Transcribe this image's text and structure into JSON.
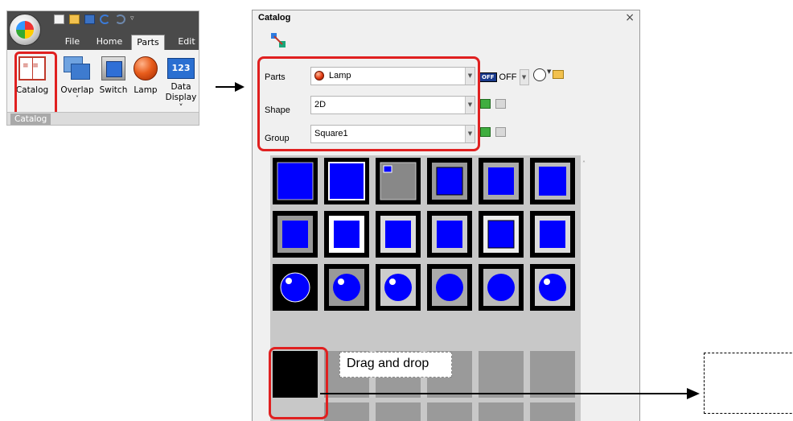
{
  "ribbon": {
    "quick_access_more": "▿",
    "tabs": [
      {
        "label": "File",
        "active": false
      },
      {
        "label": "Home",
        "active": false
      },
      {
        "label": "Parts",
        "active": true
      },
      {
        "label": "Edit",
        "active": false
      }
    ],
    "buttons": [
      {
        "label": "Catalog",
        "icon": "catalog-book-icon"
      },
      {
        "label": "Overlap",
        "label2": "˅",
        "icon": "overlap-icon"
      },
      {
        "label": "Switch",
        "icon": "switch-icon"
      },
      {
        "label": "Lamp",
        "icon": "lamp-icon"
      },
      {
        "label": "Data",
        "label2": "Display ˅",
        "icon": "data-display-icon",
        "icon_text": "123"
      }
    ],
    "group_label": "Catalog"
  },
  "panel": {
    "title": "Catalog",
    "close": "×",
    "parts": {
      "label": "Parts",
      "value": "Lamp"
    },
    "shape": {
      "label": "Shape",
      "value": "2D"
    },
    "group": {
      "label": "Group",
      "value": "Square1"
    },
    "state": {
      "badge": "OFF",
      "value": "OFF"
    },
    "dropdown_glyph": "▼",
    "scroll_up_glyph": "˄"
  },
  "callout": {
    "text": "Drag and drop"
  },
  "colors": {
    "highlight": "#e02020",
    "part_blue": "#0000ff"
  }
}
